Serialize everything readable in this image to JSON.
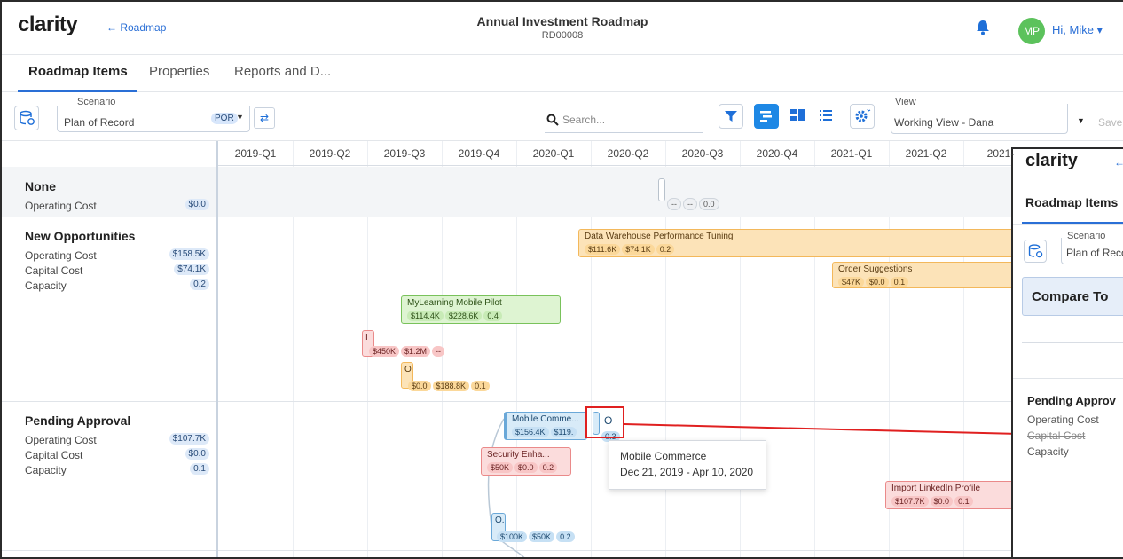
{
  "header": {
    "logo": "clarity",
    "back": "← Roadmap",
    "title": "Annual Investment Roadmap",
    "subtitle": "RD00008",
    "avatar_initials": "MP",
    "greeting": "Hi, Mike ▾"
  },
  "tabs": [
    "Roadmap Items",
    "Properties",
    "Reports and D..."
  ],
  "toolbar": {
    "scenario_label": "Scenario",
    "scenario_value": "Plan of Record",
    "scenario_badge": "POR",
    "search_placeholder": "Search...",
    "view_label": "View",
    "view_value": "Working View - Dana",
    "save_label": "Save"
  },
  "quarters": [
    "2019-Q1",
    "2019-Q2",
    "2019-Q3",
    "2019-Q4",
    "2020-Q1",
    "2020-Q2",
    "2020-Q3",
    "2020-Q4",
    "2021-Q1",
    "2021-Q2",
    "2021-"
  ],
  "groups": {
    "none": {
      "title": "None",
      "rows": [
        {
          "label": "Operating Cost",
          "value": "$0.0"
        }
      ]
    },
    "new": {
      "title": "New Opportunities",
      "rows": [
        {
          "label": "Operating Cost",
          "value": "$158.5K"
        },
        {
          "label": "Capital Cost",
          "value": "$74.1K"
        },
        {
          "label": "Capacity",
          "value": "0.2"
        }
      ]
    },
    "pending": {
      "title": "Pending Approval",
      "rows": [
        {
          "label": "Operating Cost",
          "value": "$107.7K"
        },
        {
          "label": "Capital Cost",
          "value": "$0.0"
        },
        {
          "label": "Capacity",
          "value": "0.1"
        }
      ]
    }
  },
  "items": {
    "none_item": {
      "chips": [
        "--",
        "--",
        "0.0"
      ]
    },
    "dwpt": {
      "name": "Data Warehouse Performance Tuning",
      "chips": [
        "$111.6K",
        "$74.1K",
        "0.2"
      ]
    },
    "order": {
      "name": "Order Suggestions",
      "chips": [
        "$47K",
        "$0.0",
        "0.1"
      ]
    },
    "mylearn": {
      "name": "MyLearning Mobile Pilot",
      "chips": [
        "$114.4K",
        "$228.6K",
        "0.4"
      ]
    },
    "red_small": {
      "name": "I",
      "chips": [
        "$450K",
        "$1.2M",
        "--"
      ]
    },
    "orange_small": {
      "name": "O",
      "chips": [
        "$0.0",
        "$188.8K",
        "0.1"
      ]
    },
    "mobile": {
      "name": "Mobile Comme...",
      "chips": [
        "$156.4K",
        "$119.",
        "0.3"
      ]
    },
    "mobile_o": {
      "name": "O"
    },
    "security": {
      "name": "Security Enha...",
      "chips": [
        "$50K",
        "$0.0",
        "0.2"
      ]
    },
    "blue_o": {
      "name": "O.",
      "chips": [
        "$100K",
        "$50K",
        "0.2"
      ]
    },
    "linkedin": {
      "name": "Import LinkedIn Profile",
      "chips": [
        "$107.7K",
        "$0.0",
        "0.1"
      ]
    }
  },
  "tooltip": {
    "title": "Mobile Commerce",
    "dates": "Dec 21, 2019 - Apr 10, 2020"
  },
  "panel": {
    "logo": "clarity",
    "arrow": "← I",
    "tab": "Roadmap Items",
    "scenario_label": "Scenario",
    "scenario_value": "Plan of Reco",
    "compare": "Compare To",
    "group": "Pending Approv",
    "rows": [
      "Operating Cost",
      "Capital Cost",
      "Capacity"
    ]
  }
}
